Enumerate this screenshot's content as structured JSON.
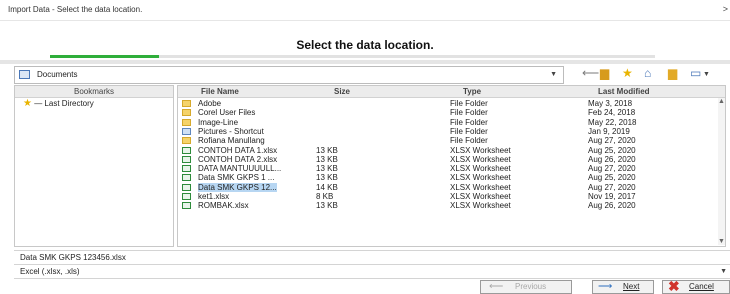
{
  "window": {
    "title": "Import Data - Select the data location.",
    "close_glyph": ">"
  },
  "header": {
    "heading": "Select the data location.",
    "progress": 0.18
  },
  "location": {
    "value": "Documents"
  },
  "colors": {
    "progress": "#2fae3a",
    "selection": "#b7d6f2",
    "cancel": "#d0342c",
    "star": "#e9b400"
  },
  "bookmarks": {
    "header": "Bookmarks",
    "items": [
      {
        "label": "— Last Directory"
      }
    ]
  },
  "file_list": {
    "columns": {
      "name": "File Name",
      "size": "Size",
      "type": "Type",
      "modified": "Last Modified"
    },
    "rows": [
      {
        "icon": "folder-icon",
        "name": "Adobe",
        "size": "",
        "type": "File Folder",
        "modified": "May 3, 2018"
      },
      {
        "icon": "folder-icon",
        "name": "Corel User Files",
        "size": "",
        "type": "File Folder",
        "modified": "Feb 24, 2018"
      },
      {
        "icon": "folder-icon",
        "name": "Image-Line",
        "size": "",
        "type": "File Folder",
        "modified": "May 22, 2018"
      },
      {
        "icon": "shortcut-icon",
        "name": "Pictures - Shortcut",
        "size": "",
        "type": "File Folder",
        "modified": "Jan 9, 2019"
      },
      {
        "icon": "folder-icon",
        "name": "Rofiana Manullang",
        "size": "",
        "type": "File Folder",
        "modified": "Aug 27, 2020"
      },
      {
        "icon": "xlsx-icon",
        "name": "CONTOH DATA 1.xlsx",
        "size": "13 KB",
        "type": "XLSX Worksheet",
        "modified": "Aug 25, 2020"
      },
      {
        "icon": "xlsx-icon",
        "name": "CONTOH DATA 2.xlsx",
        "size": "13 KB",
        "type": "XLSX Worksheet",
        "modified": "Aug 26, 2020"
      },
      {
        "icon": "xlsx-icon",
        "name": "DATA MANTUUUULL...",
        "size": "13 KB",
        "type": "XLSX Worksheet",
        "modified": "Aug 27, 2020"
      },
      {
        "icon": "xlsx-icon",
        "name": "Data SMK GKPS 1 ...",
        "size": "13 KB",
        "type": "XLSX Worksheet",
        "modified": "Aug 25, 2020"
      },
      {
        "icon": "xlsx-icon",
        "name": "Data SMK GKPS 12...",
        "size": "14 KB",
        "type": "XLSX Worksheet",
        "modified": "Aug 27, 2020",
        "selected": true
      },
      {
        "icon": "xlsx-icon",
        "name": "ket1.xlsx",
        "size": "8 KB",
        "type": "XLSX Worksheet",
        "modified": "Nov 19, 2017"
      },
      {
        "icon": "xlsx-icon",
        "name": "ROMBAK.xlsx",
        "size": "13 KB",
        "type": "XLSX Worksheet",
        "modified": "Aug 26, 2020"
      }
    ]
  },
  "filename": {
    "value": "Data SMK GKPS 123456.xlsx"
  },
  "filetype": {
    "value": "Excel (.xlsx, .xls)"
  },
  "buttons": {
    "previous": "Previous",
    "next": "Next",
    "cancel": "Cancel"
  }
}
